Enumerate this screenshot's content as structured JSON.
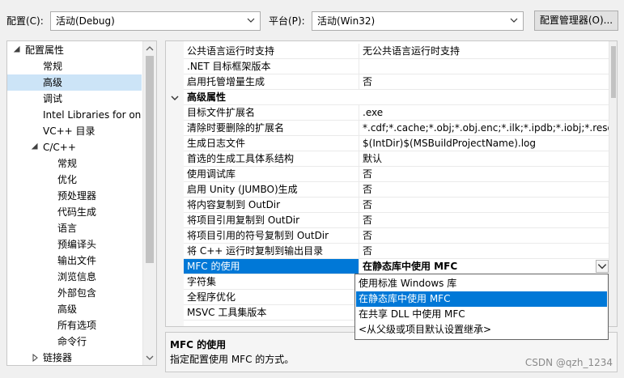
{
  "toolbar": {
    "config_label": "配置(C):",
    "config_value": "活动(Debug)",
    "platform_label": "平台(P):",
    "platform_value": "活动(Win32)",
    "config_manager_button": "配置管理器(O)..."
  },
  "tree": {
    "items": [
      {
        "label": "配置属性",
        "level": 0,
        "expanded": true
      },
      {
        "label": "常规",
        "level": 1
      },
      {
        "label": "高级",
        "level": 1,
        "selected": true
      },
      {
        "label": "调试",
        "level": 1
      },
      {
        "label": "Intel Libraries for one",
        "level": 1
      },
      {
        "label": "VC++ 目录",
        "level": 1
      },
      {
        "label": "C/C++",
        "level": 1,
        "expanded": true
      },
      {
        "label": "常规",
        "level": 2
      },
      {
        "label": "优化",
        "level": 2
      },
      {
        "label": "预处理器",
        "level": 2
      },
      {
        "label": "代码生成",
        "level": 2
      },
      {
        "label": "语言",
        "level": 2
      },
      {
        "label": "预编译头",
        "level": 2
      },
      {
        "label": "输出文件",
        "level": 2
      },
      {
        "label": "浏览信息",
        "level": 2
      },
      {
        "label": "外部包含",
        "level": 2
      },
      {
        "label": "高级",
        "level": 2
      },
      {
        "label": "所有选项",
        "level": 2
      },
      {
        "label": "命令行",
        "level": 2
      },
      {
        "label": "链接器",
        "level": 1,
        "expanded": false
      }
    ]
  },
  "grid": {
    "rows": [
      {
        "name": "公共语言运行时支持",
        "value": "无公共语言运行时支持"
      },
      {
        "name": ".NET 目标框架版本",
        "value": ""
      },
      {
        "name": "启用托管增量生成",
        "value": "否"
      },
      {
        "name": "高级属性",
        "category": true
      },
      {
        "name": "目标文件扩展名",
        "value": ".exe"
      },
      {
        "name": "清除时要删除的扩展名",
        "value": "*.cdf;*.cache;*.obj;*.obj.enc;*.ilk;*.ipdb;*.iobj;*.resource"
      },
      {
        "name": "生成日志文件",
        "value": "$(IntDir)$(MSBuildProjectName).log"
      },
      {
        "name": "首选的生成工具体系结构",
        "value": "默认"
      },
      {
        "name": "使用调试库",
        "value": "否"
      },
      {
        "name": "启用 Unity (JUMBO)生成",
        "value": "否"
      },
      {
        "name": "将内容复制到 OutDir",
        "value": "否"
      },
      {
        "name": "将项目引用复制到 OutDir",
        "value": "否"
      },
      {
        "name": "将项目引用的符号复制到 OutDir",
        "value": "否"
      },
      {
        "name": "将 C++ 运行时复制到输出目录",
        "value": "否"
      },
      {
        "name": "MFC 的使用",
        "value": "在静态库中使用 MFC",
        "selected": true
      },
      {
        "name": "字符集",
        "value": ""
      },
      {
        "name": "全程序优化",
        "value": ""
      },
      {
        "name": "MSVC 工具集版本",
        "value": ""
      }
    ]
  },
  "dropdown": {
    "options": [
      {
        "label": "使用标准 Windows 库"
      },
      {
        "label": "在静态库中使用 MFC",
        "highlighted": true
      },
      {
        "label": "在共享 DLL 中使用 MFC"
      },
      {
        "label": "<从父级或项目默认设置继承>"
      }
    ]
  },
  "description": {
    "title": "MFC 的使用",
    "text": "指定配置使用 MFC 的方式。"
  },
  "watermark": "CSDN @qzh_1234",
  "colors": {
    "selection_blue": "#0078d7",
    "tree_selection": "#cce4f7"
  }
}
